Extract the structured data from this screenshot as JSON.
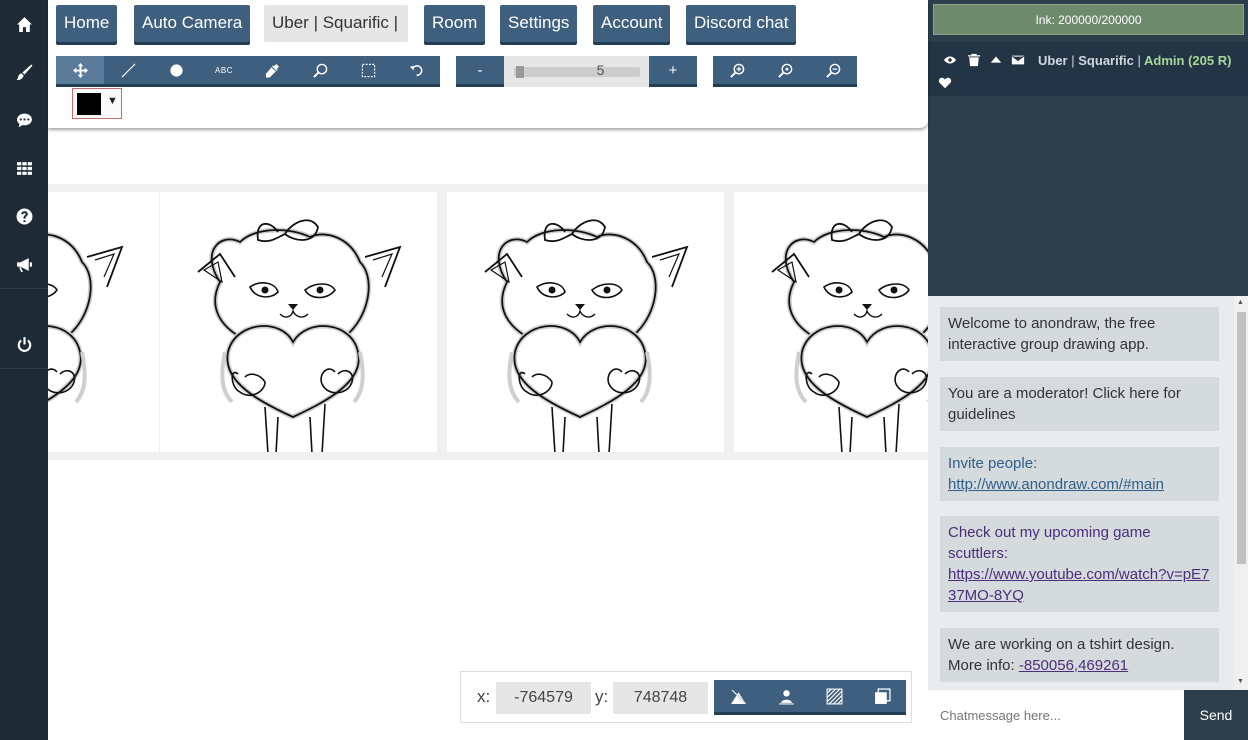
{
  "nav": {
    "home": "Home",
    "auto_camera": "Auto Camera",
    "room_name": "Uber | Squarific |",
    "room": "Room",
    "settings": "Settings",
    "account": "Account",
    "discord": "Discord chat"
  },
  "toolbar": {
    "text_tool_label": "ABC",
    "active_tool": "move",
    "brush_size": "5",
    "minus": "-",
    "plus": "+",
    "current_color": "#000000",
    "dropdown_arrow": "▼"
  },
  "left_nav_icons": [
    "home-icon",
    "brush-icon",
    "chat-bubble-icon",
    "grid-icon",
    "help-icon",
    "megaphone-icon",
    "power-icon"
  ],
  "coords": {
    "x_label": "x:",
    "x_value": "-764579",
    "y_label": "y:",
    "y_value": "748748"
  },
  "side": {
    "ink": "Ink: 200000/200000",
    "user": {
      "name1": "Uber",
      "sep1": "|",
      "name2": "Squarific",
      "sep2": "|",
      "role": "Admin (205 R)"
    }
  },
  "chat": {
    "messages": [
      {
        "text": "Welcome to anondraw, the free interactive group drawing app."
      },
      {
        "text": "You are a moderator! Click here for guidelines"
      },
      {
        "prefix": "Invite people:",
        "link": "http://www.anondraw.com/#main"
      },
      {
        "prefix": "Check out my upcoming game scuttlers:",
        "link": "https://www.youtube.com/watch?v=pE737MO-8YQ"
      },
      {
        "prefix": "We are working on a tshirt design. More info:",
        "link": "-850056,469261"
      }
    ],
    "input_placeholder": "Chatmessage here...",
    "send_label": "Send"
  },
  "colors": {
    "nav_button": "#3f5f7f",
    "sidebar": "#1e2b36",
    "right_panel": "#2c3e4c",
    "ink_bar": "#6e8a6c",
    "admin_green": "#a9d69a"
  }
}
